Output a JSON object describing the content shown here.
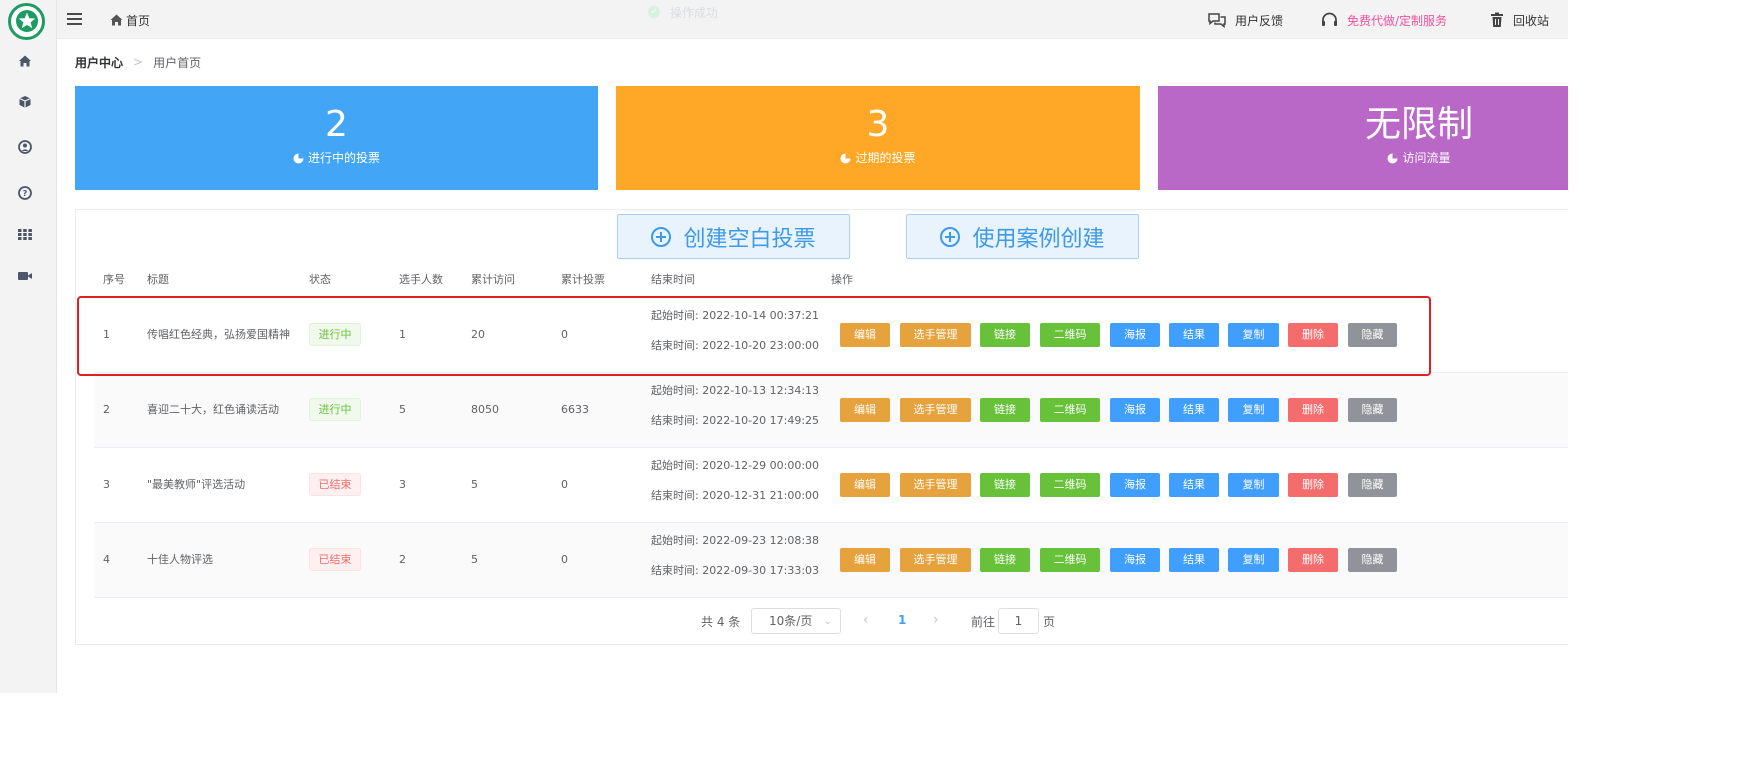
{
  "header": {
    "home": "首页",
    "toast": "操作成功",
    "feedback": "用户反馈",
    "service": "免费代做/定制服务",
    "recycle": "回收站"
  },
  "breadcrumb": {
    "parent": "用户中心",
    "current": "用户首页"
  },
  "stats": [
    {
      "value": "2",
      "label": "进行中的投票",
      "color": "#42a5f5"
    },
    {
      "value": "3",
      "label": "过期的投票",
      "color": "#ffa726"
    },
    {
      "value": "无限制",
      "label": "访问流量",
      "color": "#ba68c8"
    }
  ],
  "actions": {
    "create_blank": "创建空白投票",
    "create_from_case": "使用案例创建"
  },
  "table": {
    "headers": [
      "序号",
      "标题",
      "状态",
      "选手人数",
      "累计访问",
      "累计投票",
      "结束时间",
      "操作"
    ],
    "operations": [
      "编辑",
      "选手管理",
      "链接",
      "二维码",
      "海报",
      "结果",
      "复制",
      "删除",
      "隐藏"
    ],
    "rows": [
      {
        "index": "1",
        "title": "传唱红色经典，弘扬爱国精神",
        "status": "进行中",
        "status_type": "active",
        "players": "1",
        "visits": "20",
        "votes": "0",
        "start": "起始时间: 2022-10-14 00:37:21",
        "end": "结束时间: 2022-10-20 23:00:00"
      },
      {
        "index": "2",
        "title": "喜迎二十大，红色诵读活动",
        "status": "进行中",
        "status_type": "active",
        "players": "5",
        "visits": "8050",
        "votes": "6633",
        "start": "起始时间: 2022-10-13 12:34:13",
        "end": "结束时间: 2022-10-20 17:49:25"
      },
      {
        "index": "3",
        "title": "\"最美教师\"评选活动",
        "status": "已结束",
        "status_type": "ended",
        "players": "3",
        "visits": "5",
        "votes": "0",
        "start": "起始时间: 2020-12-29 00:00:00",
        "end": "结束时间: 2020-12-31 21:00:00"
      },
      {
        "index": "4",
        "title": "十佳人物评选",
        "status": "已结束",
        "status_type": "ended",
        "players": "2",
        "visits": "5",
        "votes": "0",
        "start": "起始时间: 2022-09-23 12:08:38",
        "end": "结束时间: 2022-09-30 17:33:03"
      }
    ]
  },
  "pagination": {
    "total": "共 4 条",
    "page_size": "10条/页",
    "current_page": "1",
    "goto_label": "前往",
    "goto_value": "1",
    "unit": "页"
  },
  "icons": {
    "sidebar": [
      "home-icon",
      "box-icon",
      "user-icon",
      "help-icon",
      "apps-icon",
      "video-icon"
    ]
  }
}
